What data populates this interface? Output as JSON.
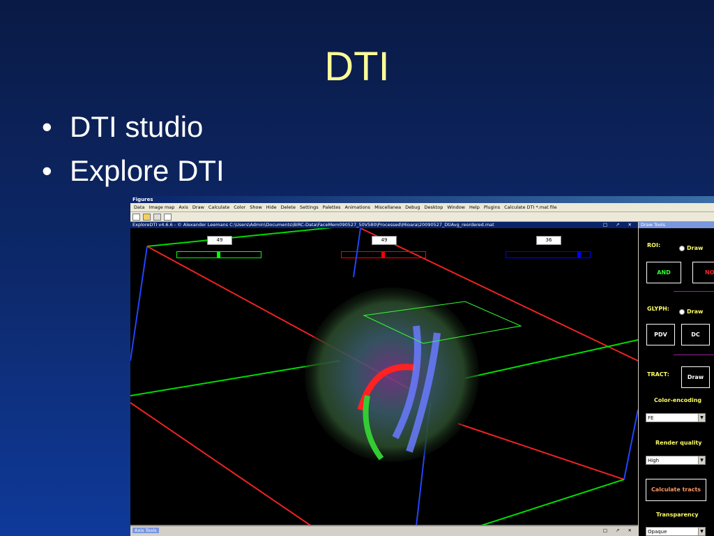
{
  "slide": {
    "title": "DTI",
    "bullets": [
      "DTI studio",
      "Explore DTI"
    ]
  },
  "window": {
    "title": "Figures",
    "menu": [
      "Data",
      "Image map",
      "Axis",
      "Draw",
      "Calculate",
      "Color",
      "Show",
      "Hide",
      "Delete",
      "Settings",
      "Palettes",
      "Animations",
      "Miscellanea",
      "Debug",
      "Desktop",
      "Window",
      "Help",
      "Plugins",
      "Calculate DTI *.mat file"
    ],
    "viewer_title": "ExploreDTI v4.6.6 - © Alexander Leemans  C:\\Users\\Admin\\Documents\\BIRC-Data\\FaceMem090527_50V580\\Processed\\Mioara\\20090527_DtiAvg_reordered.mat",
    "slices": [
      {
        "value": "49",
        "color": "#00ff00",
        "position": 0.5
      },
      {
        "value": "49",
        "color": "#ff0000",
        "position": 0.5
      },
      {
        "value": "36",
        "color": "#0000ff",
        "position": 0.9
      }
    ],
    "axis_tools_label": "Axis Tools"
  },
  "draw_tools": {
    "header": "Draw Tools",
    "roi_label": "ROI:",
    "roi_radio": "Draw",
    "and_button": "AND",
    "not_button": "NOT",
    "glyph_label": "GLYPH:",
    "glyph_radio": "Draw",
    "pdv_button": "PDV",
    "dc_button": "DC",
    "tract_label": "TRACT:",
    "tract_button": "Draw",
    "color_encoding_label": "Color-encoding",
    "color_encoding_value": "FE",
    "render_quality_label": "Render quality",
    "render_quality_value": "High",
    "calc_button": "Calculate tracts",
    "transparency_label": "Transparency",
    "transparency_value": "Opaque"
  }
}
